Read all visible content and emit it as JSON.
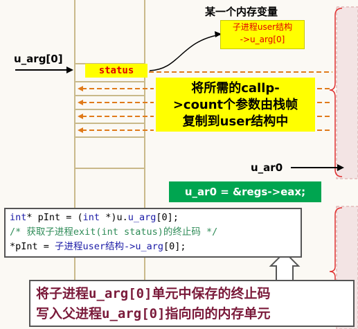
{
  "labels": {
    "variable_title": "某一个内存变量",
    "u_arg0_left": "u_arg[0]",
    "status": "status",
    "u_ar0": "u_ar0"
  },
  "callouts": {
    "top_line1": "子进程user结构",
    "top_line2": "->u_arg[0]",
    "mid_line1": "将所需的callp-",
    "mid_line2": ">count个参数由栈帧",
    "mid_line3": "复制到user结构中",
    "green": "u_ar0 = &regs->eax;"
  },
  "code": {
    "line1_kw1": "int",
    "line1_a": "* pInt = (",
    "line1_kw2": "int",
    "line1_b": " *)u.",
    "line1_var": "u_arg",
    "line1_c": "[0];",
    "line2": "/* 获取子进程exit(int status)的终止码 */",
    "line3_a": "*pInt = ",
    "line3_cn": "子进程user结构->",
    "line3_var": "u_arg",
    "line3_c": "[0];"
  },
  "bottom": {
    "line1_a": "将子进程",
    "line1_mono": "u_arg[0]",
    "line1_b": "单元中保存的终止码",
    "line2_a": "写入父进程",
    "line2_mono": "u_arg[0]",
    "line2_b": "指向向的内存单元"
  },
  "colors": {
    "yellow": "#ffff00",
    "red": "#e00000",
    "green": "#00a550",
    "orange_dash": "#e07a1a",
    "stack_line": "#c9b98a",
    "pink_panel": "#f3e4e4"
  }
}
